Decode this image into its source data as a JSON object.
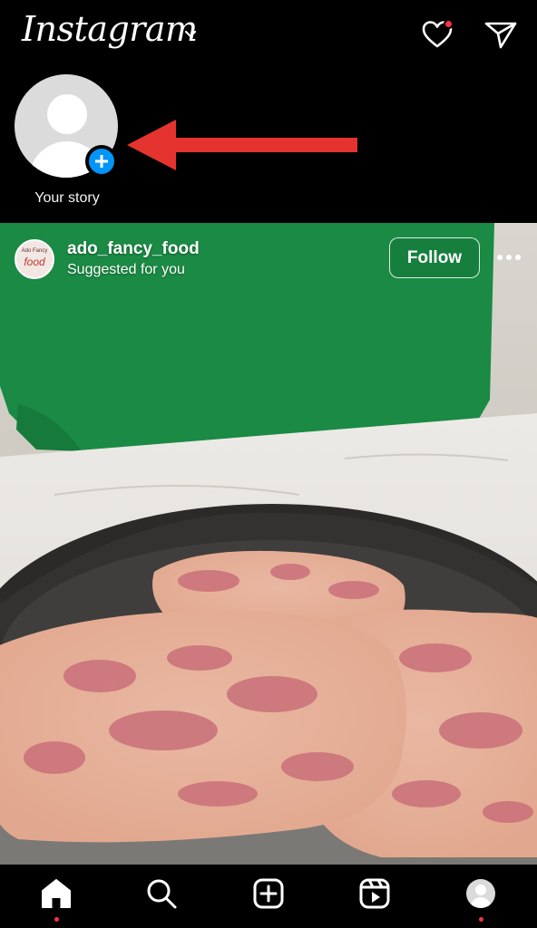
{
  "app": {
    "title": "Instagram"
  },
  "header": {
    "icons": [
      "chevron-down-icon",
      "heart-icon",
      "send-icon"
    ],
    "notification_dot_color": "#ff3040"
  },
  "stories": {
    "own_story_label": "Your story",
    "add_button_color": "#0095f6",
    "annotation": "red-arrow-pointing-to-add-story"
  },
  "post": {
    "username": "ado_fancy_food",
    "subtitle": "Suggested for you",
    "follow_label": "Follow",
    "avatar_text_line1": "Ado Fancy",
    "avatar_text_line2": "food",
    "more_icon": "more-horizontal-icon"
  },
  "bottom_nav": {
    "items": [
      "home-icon",
      "search-icon",
      "create-icon",
      "reels-icon",
      "profile-icon"
    ],
    "active": "home",
    "dot_color": "#ff3040"
  },
  "colors": {
    "background": "#000000",
    "accent": "#0095f6",
    "arrow": "#e5342f"
  }
}
